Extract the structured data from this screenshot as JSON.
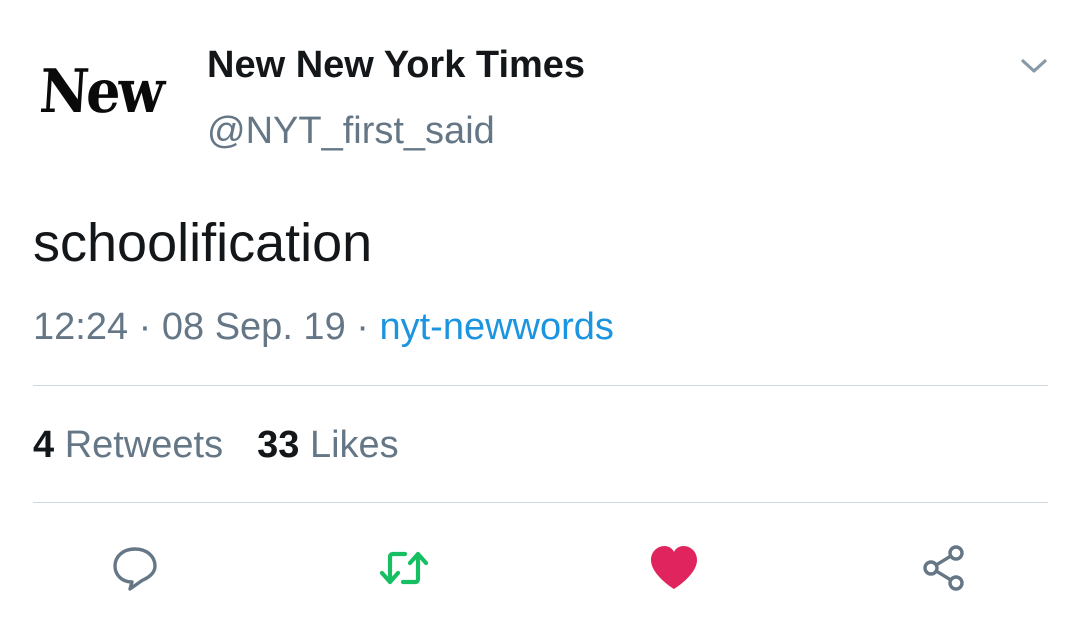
{
  "tweet": {
    "avatar_text": "New",
    "display_name": "New New York Times",
    "handle": "@NYT_first_said",
    "text": "schoolification",
    "time": "12:24",
    "separator": " · ",
    "date": "08 Sep. 19",
    "source": "nyt-newwords",
    "retweets": {
      "count": "4",
      "label": "Retweets"
    },
    "likes": {
      "count": "33",
      "label": "Likes"
    }
  },
  "icons": {
    "menu": "chevron-down-icon",
    "reply": "speech-bubble-icon",
    "retweet": "retweet-icon",
    "like": "heart-icon",
    "share": "share-icon"
  },
  "colors": {
    "text_primary": "#14171a",
    "text_secondary": "#657786",
    "link": "#1b95e0",
    "retweet_active": "#17bf63",
    "like_active": "#e0245e",
    "divider": "#ccd6dd"
  }
}
